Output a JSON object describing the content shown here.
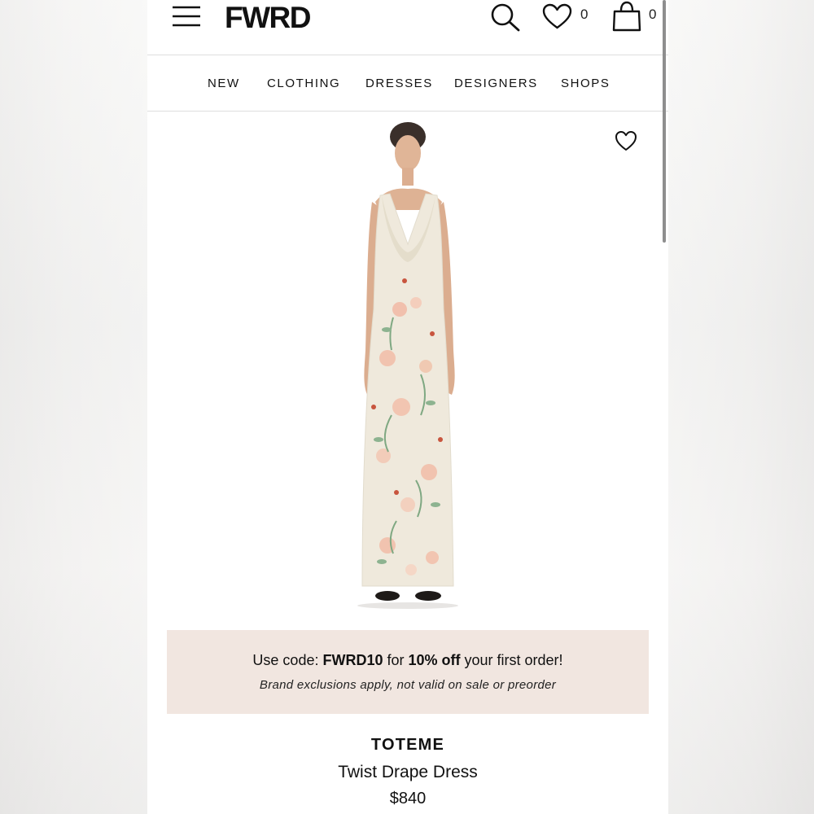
{
  "header": {
    "logo": "FWRD",
    "wishlist_count": "0",
    "bag_count": "0"
  },
  "nav": {
    "items": [
      {
        "label": "NEW"
      },
      {
        "label": "CLOTHING"
      },
      {
        "label": "DRESSES"
      },
      {
        "label": "DESIGNERS"
      },
      {
        "label": "SHOPS"
      }
    ]
  },
  "promo": {
    "prefix": "Use code: ",
    "code": "FWRD10",
    "middle": " for ",
    "discount": "10% off",
    "suffix": " your first order!",
    "note": "Brand exclusions apply, not valid on sale or preorder"
  },
  "product": {
    "brand": "TOTEME",
    "name": "Twist Drape Dress",
    "price": "$840"
  },
  "colors": {
    "promo_bg": "#f1e6e0",
    "dress": "#efe9dc",
    "flower": "#f1b9a4",
    "leaf": "#7fa882"
  },
  "icons": [
    "menu-icon",
    "search-icon",
    "heart-icon",
    "shopping-bag-icon"
  ]
}
